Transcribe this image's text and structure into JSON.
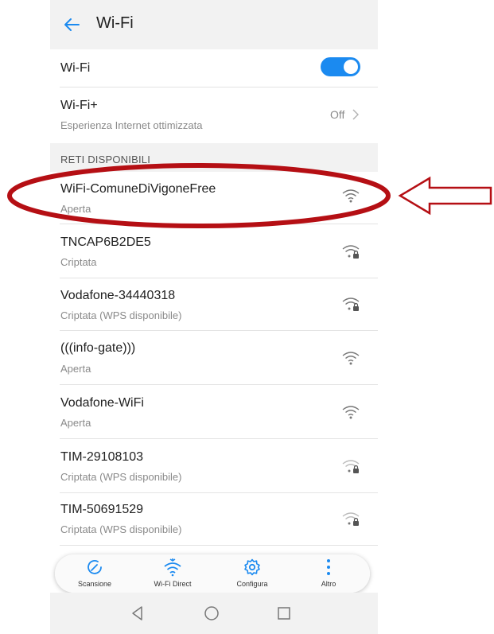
{
  "header": {
    "title": "Wi-Fi"
  },
  "wifi_toggle": {
    "label": "Wi-Fi",
    "on": true
  },
  "wifi_plus": {
    "label": "Wi-Fi+",
    "subtitle": "Esperienza Internet ottimizzata",
    "status": "Off"
  },
  "section_header": "RETI DISPONIBILI",
  "networks": [
    {
      "name": "WiFi-ComuneDiVigoneFree",
      "security": "Aperta",
      "locked": false,
      "highlighted": true
    },
    {
      "name": "TNCAP6B2DE5",
      "security": "Criptata",
      "locked": true
    },
    {
      "name": "Vodafone-34440318",
      "security": "Criptata (WPS disponibile)",
      "locked": true
    },
    {
      "name": "(((info-gate)))",
      "security": "Aperta",
      "locked": false
    },
    {
      "name": "Vodafone-WiFi",
      "security": "Aperta",
      "locked": false
    },
    {
      "name": "TIM-29108103",
      "security": "Criptata (WPS disponibile)",
      "locked": true
    },
    {
      "name": "TIM-50691529",
      "security": "Criptata (WPS disponibile)",
      "locked": true
    }
  ],
  "bottom_bar": {
    "scan": "Scansione",
    "wifi_direct": "Wi-Fi Direct",
    "configure": "Configura",
    "more": "Altro"
  },
  "colors": {
    "accent": "#1b8af0",
    "annotation": "#b50f14"
  },
  "icons": [
    "back-arrow-icon",
    "chevron-right-icon",
    "wifi-signal-icon",
    "wifi-lock-icon",
    "refresh-icon",
    "wifi-direct-icon",
    "gear-icon",
    "more-vert-icon",
    "nav-back-icon",
    "nav-home-icon",
    "nav-recents-icon"
  ]
}
